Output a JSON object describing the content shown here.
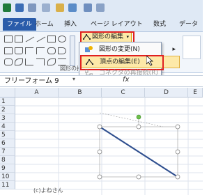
{
  "ribbon_tabs": [
    "ファイル",
    "ホーム",
    "挿入",
    "ページ レイアウト",
    "数式",
    "データ"
  ],
  "edit_shape_button": "図形の編集",
  "menu": {
    "items": [
      {
        "label": "図形の変更(N)",
        "state": "normal",
        "icon": "change-shape-icon",
        "has_submenu": true
      },
      {
        "label": "頂点の編集(E)",
        "state": "highlighted",
        "icon": "edit-points-icon"
      },
      {
        "label": "コネクタの再接続(R)",
        "state": "disabled",
        "icon": "reroute-connector-icon"
      }
    ]
  },
  "group_label": "図形の挿",
  "name_box": "フリーフォーム 9",
  "formula_symbol": "fx",
  "columns": [
    "A",
    "B",
    "C",
    "D",
    "E"
  ],
  "rows": [
    "1",
    "2",
    "3",
    "4",
    "5",
    "6",
    "7",
    "8",
    "9",
    "10",
    "11"
  ],
  "credit": "(c)よねさん",
  "colors": {
    "highlight": "#fde9a8",
    "red_box": "#e02020",
    "line": "#2f4f8f",
    "file_tab": "#2a5caa",
    "rotation_handle": "#6ec04a"
  }
}
